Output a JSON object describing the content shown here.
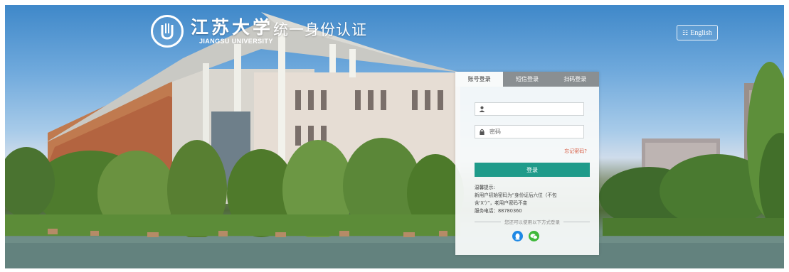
{
  "header": {
    "logo_cn": "江苏大学",
    "logo_en": "JIANGSU UNIVERSITY",
    "system_title": "统一身份认证"
  },
  "language_button": {
    "label": "English"
  },
  "login": {
    "tabs": [
      {
        "label": "账号登录",
        "active": true
      },
      {
        "label": "短信登录",
        "active": false
      },
      {
        "label": "扫码登录",
        "active": false
      }
    ],
    "username": {
      "value": "",
      "placeholder": ""
    },
    "password": {
      "value": "",
      "placeholder": "密码"
    },
    "forgot_label": "忘记密码?",
    "submit_label": "登录",
    "tips": {
      "title": "温馨提示:",
      "line1": "新用户初始密码为“身份证后六位（不包",
      "line2": "含'X'）”，老用户密码不变",
      "line3": "服务电话：88780360"
    },
    "alt_login_text": "您还可以使用以下方式登录",
    "alt_methods": [
      {
        "name": "qq",
        "icon": "qq-icon",
        "color": "#1e88e5"
      },
      {
        "name": "wechat",
        "icon": "wechat-icon",
        "color": "#3fb83a"
      }
    ]
  },
  "colors": {
    "accent": "#1f9b8a",
    "forgot": "#d65a41"
  }
}
